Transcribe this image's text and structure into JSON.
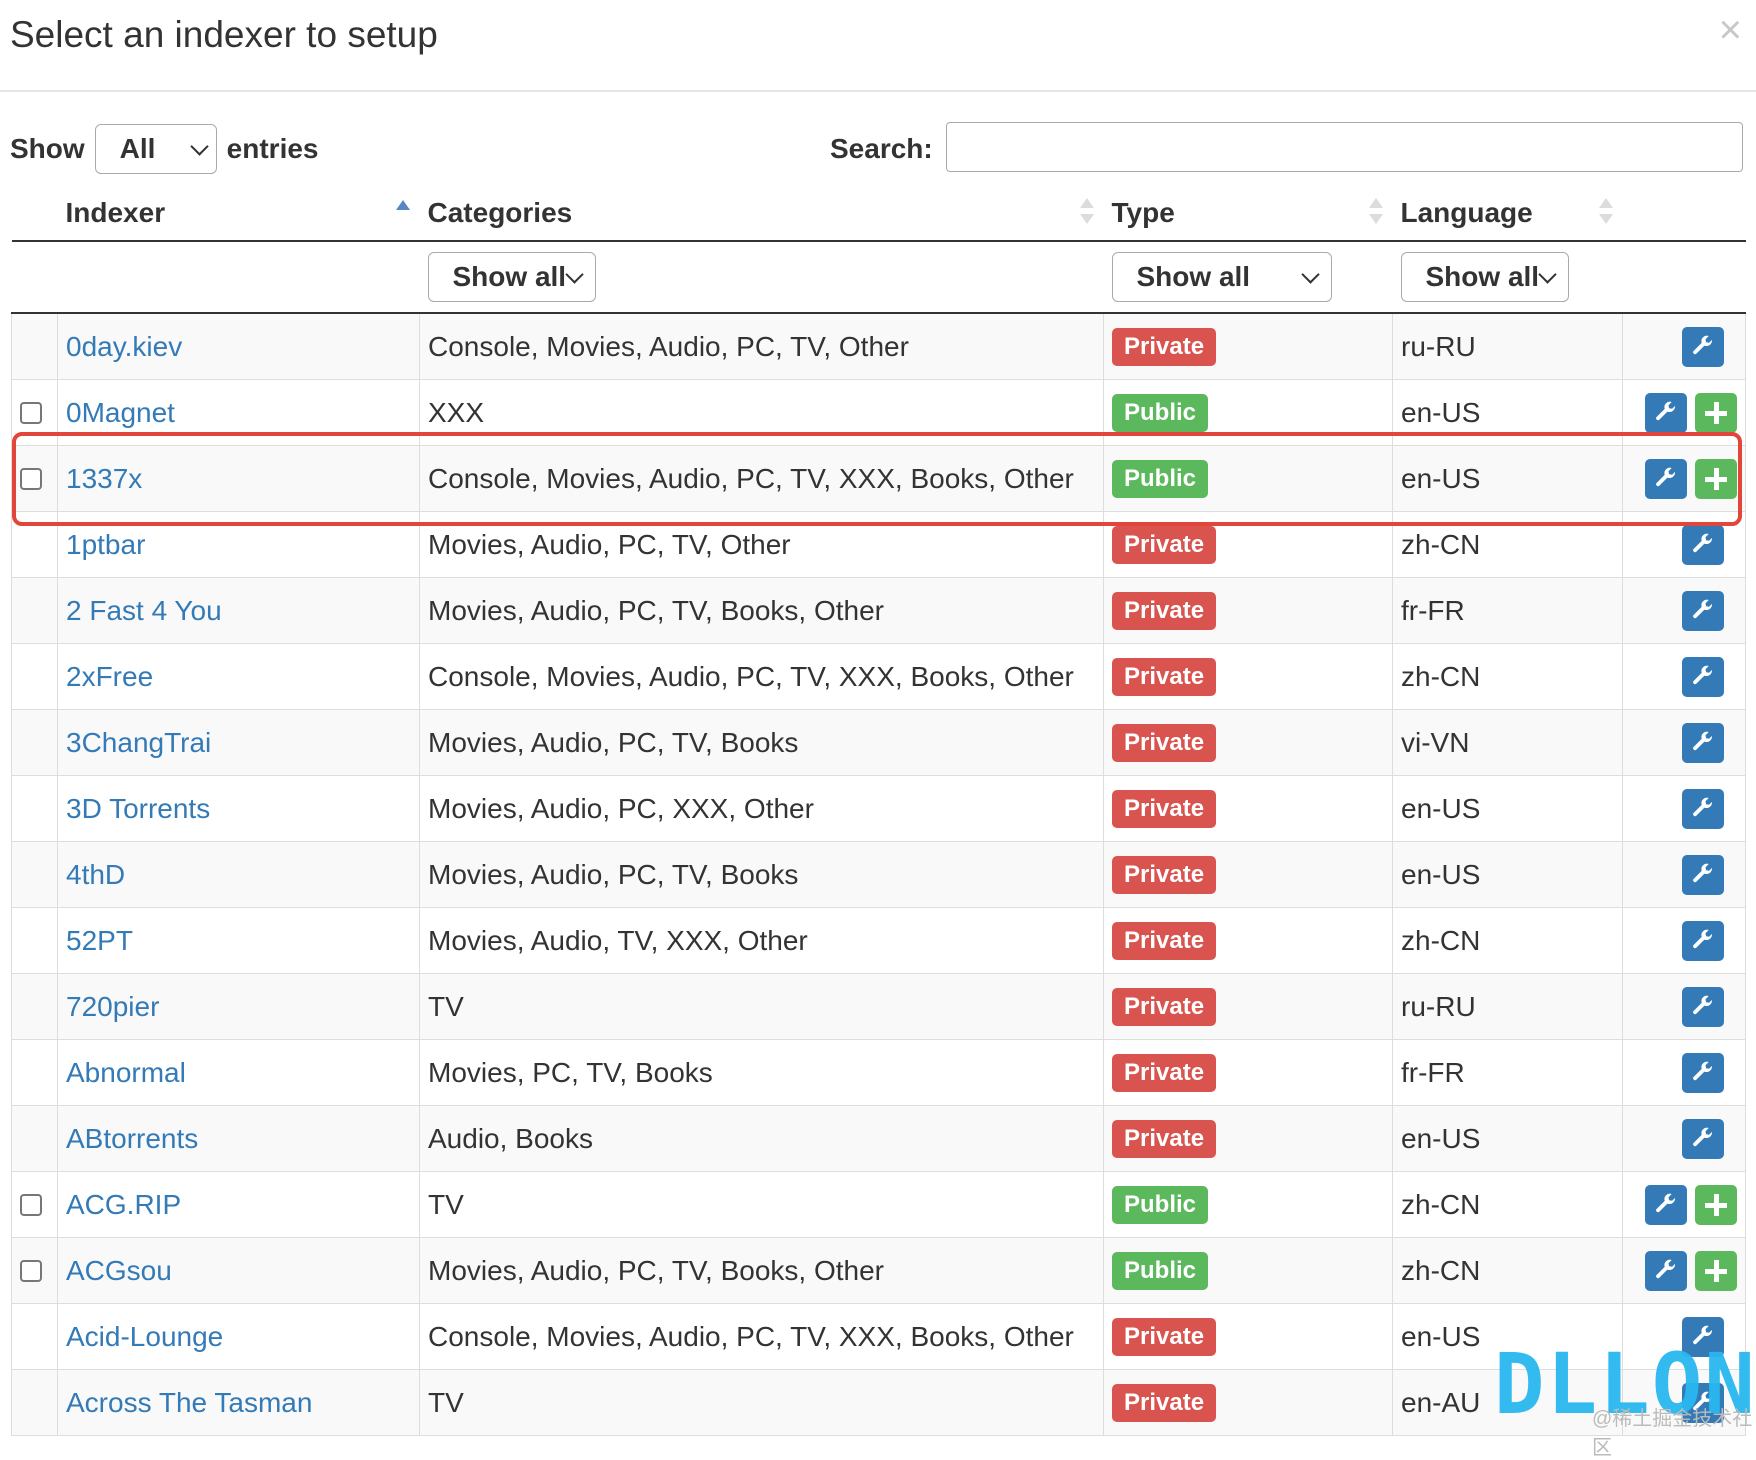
{
  "modal": {
    "title": "Select an indexer to setup",
    "close": "×"
  },
  "controls": {
    "show_label": "Show",
    "length_value": "All",
    "entries_label": "entries",
    "search_label": "Search:",
    "search_value": ""
  },
  "columns": {
    "indexer": "Indexer",
    "categories": "Categories",
    "type": "Type",
    "language": "Language"
  },
  "filters": {
    "categories": "Show all",
    "type": "Show all",
    "language": "Show all"
  },
  "colors": {
    "private": "#d9534f",
    "public": "#5cb85c",
    "configure": "#337ab7",
    "add": "#5cb85c",
    "link": "#337ab7",
    "highlight": "#e2453a"
  },
  "rows": [
    {
      "name": "0day.kiev",
      "categories": "Console, Movies, Audio, PC, TV, Other",
      "type": "Private",
      "language": "ru-RU"
    },
    {
      "name": "0Magnet",
      "categories": "XXX",
      "type": "Public",
      "language": "en-US"
    },
    {
      "name": "1337x",
      "categories": "Console, Movies, Audio, PC, TV, XXX, Books, Other",
      "type": "Public",
      "language": "en-US"
    },
    {
      "name": "1ptbar",
      "categories": "Movies, Audio, PC, TV, Other",
      "type": "Private",
      "language": "zh-CN"
    },
    {
      "name": "2 Fast 4 You",
      "categories": "Movies, Audio, PC, TV, Books, Other",
      "type": "Private",
      "language": "fr-FR"
    },
    {
      "name": "2xFree",
      "categories": "Console, Movies, Audio, PC, TV, XXX, Books, Other",
      "type": "Private",
      "language": "zh-CN"
    },
    {
      "name": "3ChangTrai",
      "categories": "Movies, Audio, PC, TV, Books",
      "type": "Private",
      "language": "vi-VN"
    },
    {
      "name": "3D Torrents",
      "categories": "Movies, Audio, PC, XXX, Other",
      "type": "Private",
      "language": "en-US"
    },
    {
      "name": "4thD",
      "categories": "Movies, Audio, PC, TV, Books",
      "type": "Private",
      "language": "en-US"
    },
    {
      "name": "52PT",
      "categories": "Movies, Audio, TV, XXX, Other",
      "type": "Private",
      "language": "zh-CN"
    },
    {
      "name": "720pier",
      "categories": "TV",
      "type": "Private",
      "language": "ru-RU"
    },
    {
      "name": "Abnormal",
      "categories": "Movies, PC, TV, Books",
      "type": "Private",
      "language": "fr-FR"
    },
    {
      "name": "ABtorrents",
      "categories": "Audio, Books",
      "type": "Private",
      "language": "en-US"
    },
    {
      "name": "ACG.RIP",
      "categories": "TV",
      "type": "Public",
      "language": "zh-CN"
    },
    {
      "name": "ACGsou",
      "categories": "Movies, Audio, PC, TV, Books, Other",
      "type": "Public",
      "language": "zh-CN"
    },
    {
      "name": "Acid-Lounge",
      "categories": "Console, Movies, Audio, PC, TV, XXX, Books, Other",
      "type": "Private",
      "language": "en-US"
    },
    {
      "name": "Across The Tasman",
      "categories": "TV",
      "type": "Private",
      "language": "en-AU"
    }
  ],
  "watermark": {
    "text": "DLLONX",
    "sub": "@稀土掘金技术社区"
  }
}
